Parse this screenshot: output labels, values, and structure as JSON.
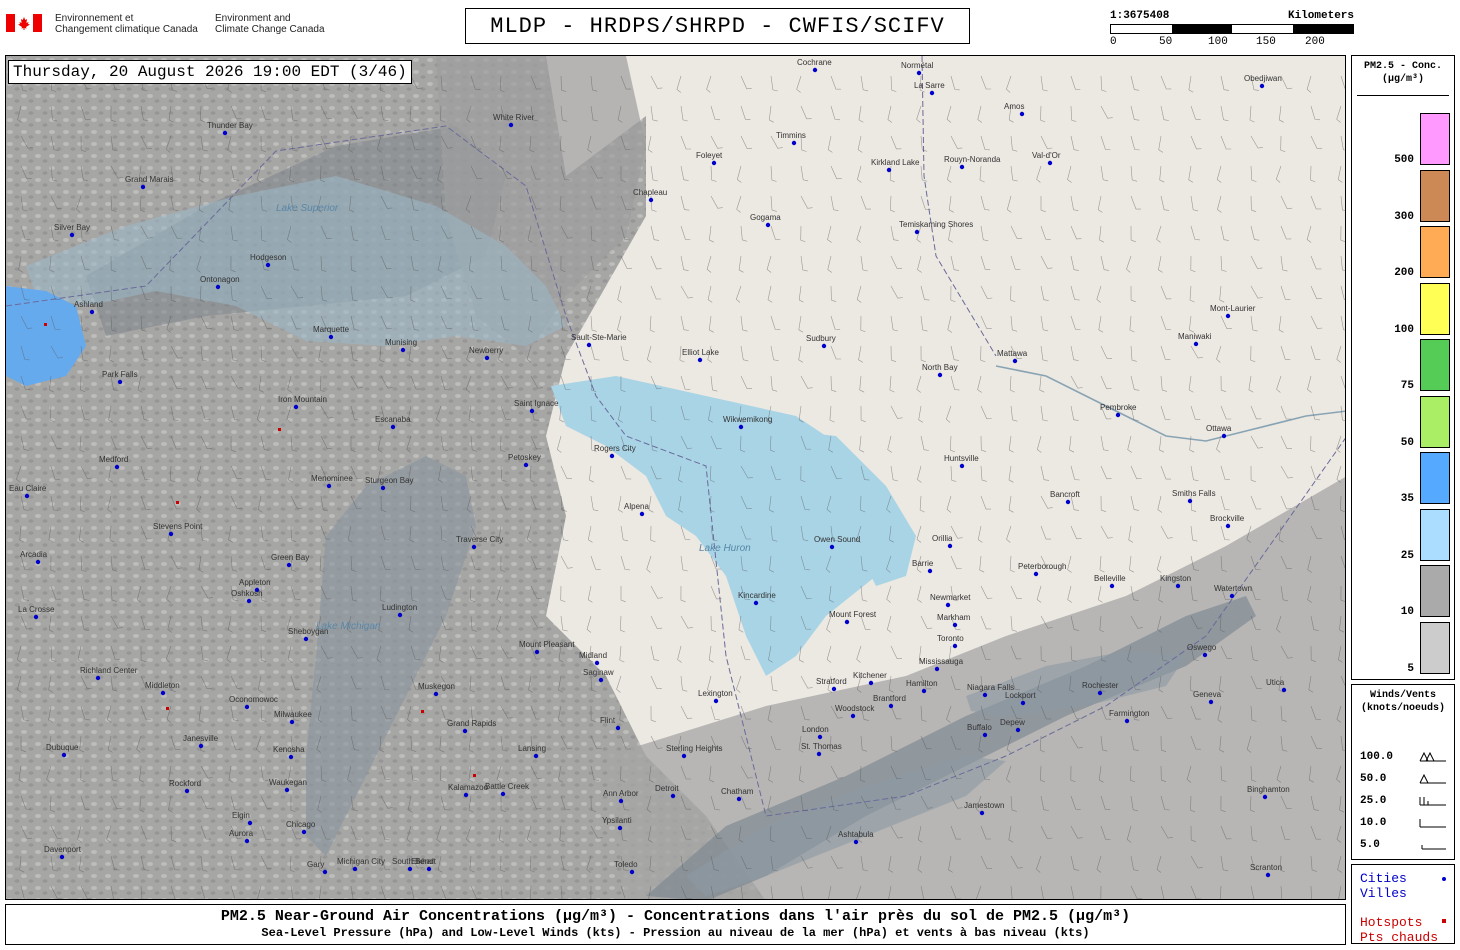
{
  "header": {
    "gov_fr": [
      "Environnement et",
      "Changement climatique Canada"
    ],
    "gov_en": [
      "Environment and",
      "Climate Change Canada"
    ],
    "title": "MLDP - HRDPS/SHRPD - CWFIS/SCIFV",
    "scale": {
      "ratio": "1:3675408",
      "units": "Kilometers",
      "ticks": [
        "0",
        "50",
        "100",
        "150",
        "200"
      ]
    }
  },
  "map": {
    "timestamp": "Thursday, 20 August 2026 19:00 EDT (3/46)",
    "lake_labels": [
      "Lake Huron",
      "Lake Michigan",
      "Lake Superior"
    ],
    "cities": [
      [
        "Cochrane",
        815,
        70
      ],
      [
        "Normétal",
        919,
        73
      ],
      [
        "La Sarre",
        932,
        93
      ],
      [
        "Amos",
        1022,
        114
      ],
      [
        "Obedjiwan",
        1262,
        86
      ],
      [
        "Thunder Bay",
        225,
        133
      ],
      [
        "White River",
        511,
        125
      ],
      [
        "Timmins",
        794,
        143
      ],
      [
        "Foleyet",
        714,
        163
      ],
      [
        "Kirkland Lake",
        889,
        170
      ],
      [
        "Rouyn-Noranda",
        962,
        167
      ],
      [
        "Val-d'Or",
        1050,
        163
      ],
      [
        "Grand Marais",
        143,
        187
      ],
      [
        "Chapleau",
        651,
        200
      ],
      [
        "Gogama",
        768,
        225
      ],
      [
        "Temiskaming Shores",
        917,
        232
      ],
      [
        "Silver Bay",
        72,
        235
      ],
      [
        "Hodgeson",
        268,
        265
      ],
      [
        "Ontonagon",
        218,
        287
      ],
      [
        "Ashland",
        92,
        312
      ],
      [
        "Marquette",
        331,
        337
      ],
      [
        "Munising",
        403,
        350
      ],
      [
        "Mont-Laurier",
        1228,
        316
      ],
      [
        "Maniwaki",
        1196,
        344
      ],
      [
        "Sault-Ste-Marie",
        589,
        345
      ],
      [
        "Elliot Lake",
        700,
        360
      ],
      [
        "Sudbury",
        824,
        346
      ],
      [
        "North Bay",
        940,
        375
      ],
      [
        "Mattawa",
        1015,
        361
      ],
      [
        "Newberry",
        487,
        358
      ],
      [
        "Park Falls",
        120,
        382
      ],
      [
        "Iron Mountain",
        296,
        407
      ],
      [
        "Pembroke",
        1118,
        415
      ],
      [
        "Saint Ignace",
        532,
        411
      ],
      [
        "Escanaba",
        393,
        427
      ],
      [
        "Wikwemikong",
        741,
        427
      ],
      [
        "Ottawa",
        1224,
        436
      ],
      [
        "Rogers City",
        612,
        456
      ],
      [
        "Huntsville",
        962,
        466
      ],
      [
        "Medford",
        117,
        467
      ],
      [
        "Petoskey",
        526,
        465
      ],
      [
        "Menominee",
        329,
        486
      ],
      [
        "Sturgeon Bay",
        383,
        488
      ],
      [
        "Bancroft",
        1068,
        502
      ],
      [
        "Smiths Falls",
        1190,
        501
      ],
      [
        "Eau Claire",
        27,
        496
      ],
      [
        "Alpena",
        642,
        514
      ],
      [
        "Stevens Point",
        171,
        534
      ],
      [
        "Traverse City",
        474,
        547
      ],
      [
        "Owen Sound",
        832,
        547
      ],
      [
        "Orillia",
        950,
        546
      ],
      [
        "Brockville",
        1228,
        526
      ],
      [
        "Green Bay",
        289,
        565
      ],
      [
        "Barrie",
        930,
        571
      ],
      [
        "Peterborough",
        1036,
        574
      ],
      [
        "Arcadia",
        38,
        562
      ],
      [
        "Appleton",
        257,
        590
      ],
      [
        "Oshkosh",
        249,
        601
      ],
      [
        "Belleville",
        1112,
        586
      ],
      [
        "Kingston",
        1178,
        586
      ],
      [
        "Watertown",
        1232,
        596
      ],
      [
        "Kincardine",
        756,
        603
      ],
      [
        "Newmarket",
        948,
        605
      ],
      [
        "La Crosse",
        36,
        617
      ],
      [
        "Ludington",
        400,
        615
      ],
      [
        "Sheboygan",
        306,
        639
      ],
      [
        "Mount Forest",
        847,
        622
      ],
      [
        "Markham",
        955,
        625
      ],
      [
        "Toronto",
        955,
        646
      ],
      [
        "Mississauga",
        937,
        669
      ],
      [
        "Mount Pleasant",
        537,
        652
      ],
      [
        "Midland",
        597,
        663
      ],
      [
        "Oswego",
        1205,
        655
      ],
      [
        "Richland Center",
        98,
        678
      ],
      [
        "Saginaw",
        601,
        680
      ],
      [
        "Muskegon",
        436,
        694
      ],
      [
        "Kitchener",
        871,
        683
      ],
      [
        "Hamilton",
        924,
        691
      ],
      [
        "Stratford",
        834,
        689
      ],
      [
        "Rochester",
        1100,
        693
      ],
      [
        "Middleton",
        163,
        693
      ],
      [
        "Oconomowoc",
        247,
        707
      ],
      [
        "Milwaukee",
        292,
        722
      ],
      [
        "Brantford",
        891,
        706
      ],
      [
        "Niagara Falls",
        985,
        695
      ],
      [
        "Woodstock",
        853,
        716
      ],
      [
        "Lexington",
        716,
        701
      ],
      [
        "Lockport",
        1023,
        703
      ],
      [
        "Buffalo",
        985,
        735
      ],
      [
        "Depew",
        1018,
        730
      ],
      [
        "Farmington",
        1127,
        721
      ],
      [
        "Geneva",
        1211,
        702
      ],
      [
        "Utica",
        1284,
        690
      ],
      [
        "Flint",
        618,
        728
      ],
      [
        "Janesville",
        201,
        746
      ],
      [
        "Dubuque",
        64,
        755
      ],
      [
        "Kenosha",
        291,
        757
      ],
      [
        "London",
        820,
        737
      ],
      [
        "St. Thomas",
        819,
        754
      ],
      [
        "Grand Rapids",
        465,
        731
      ],
      [
        "Lansing",
        536,
        756
      ],
      [
        "Sterling Heights",
        684,
        756
      ],
      [
        "Rockford",
        187,
        791
      ],
      [
        "Waukegan",
        287,
        790
      ],
      [
        "Detroit",
        673,
        796
      ],
      [
        "Chatham",
        739,
        799
      ],
      [
        "Ann Arbor",
        621,
        801
      ],
      [
        "Kalamazoo",
        466,
        795
      ],
      [
        "Battle Creek",
        503,
        794
      ],
      [
        "Binghamton",
        1265,
        797
      ],
      [
        "Elgin",
        250,
        823
      ],
      [
        "Chicago",
        304,
        832
      ],
      [
        "Ypsilanti",
        620,
        828
      ],
      [
        "Jamestown",
        982,
        813
      ],
      [
        "Aurora",
        247,
        841
      ],
      [
        "Ashtabula",
        856,
        842
      ],
      [
        "Davenport",
        62,
        857
      ],
      [
        "Gary",
        325,
        872
      ],
      [
        "Michigan City",
        355,
        869
      ],
      [
        "South Bend",
        410,
        869
      ],
      [
        "Elkhart",
        429,
        869
      ],
      [
        "Toledo",
        632,
        872
      ],
      [
        "Scranton",
        1268,
        875
      ]
    ]
  },
  "legend": {
    "title": [
      "PM2.5 - Conc.",
      "(µg/m³)"
    ],
    "bins": [
      {
        "label": "500",
        "color": "#ff99ff"
      },
      {
        "label": "300",
        "color": "#cc8855"
      },
      {
        "label": "200",
        "color": "#ffaa55"
      },
      {
        "label": "100",
        "color": "#ffff55"
      },
      {
        "label": "75",
        "color": "#55cc55"
      },
      {
        "label": "50",
        "color": "#aaee66"
      },
      {
        "label": "35",
        "color": "#55aaff"
      },
      {
        "label": "25",
        "color": "#aaddff"
      },
      {
        "label": "10",
        "color": "#aaaaaa"
      },
      {
        "label": "5",
        "color": "#cccccc"
      }
    ]
  },
  "wind_legend": {
    "title": [
      "Winds/Vents",
      "(knots/noeuds)"
    ],
    "rows": [
      "100.0",
      "50.0",
      "25.0",
      "10.0",
      "5.0"
    ]
  },
  "cities_legend": {
    "cities": [
      "Cities",
      "Villes"
    ],
    "hotspots": [
      "Hotspots",
      "Pts chauds"
    ]
  },
  "footer": {
    "line1": "PM2.5 Near-Ground Air Concentrations (µg/m³) - Concentrations dans l'air près du sol de PM2.5 (µg/m³)",
    "line2": "Sea-Level Pressure (hPa) and Low-Level Winds (kts) - Pression au niveau de la mer (hPa) et vents à bas niveau (kts)"
  },
  "colors": {
    "water": "#a8d4e6",
    "land": "#ece8e2",
    "smoke_light": "#b8b8b8",
    "smoke_dark": "#8e8e8e",
    "city_dot": "#0000cc",
    "hotspot": "#cc0000"
  }
}
